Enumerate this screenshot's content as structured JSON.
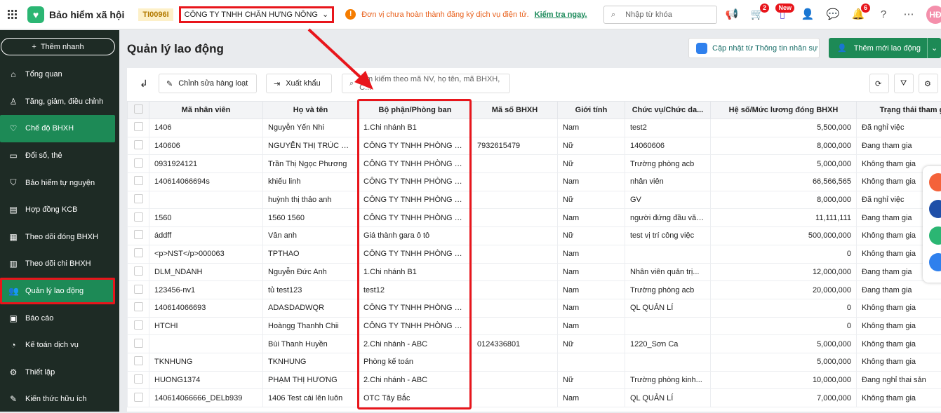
{
  "topbar": {
    "app_title": "Bảo hiểm xã hội",
    "tax_code": "TI0096I",
    "company": "CÔNG TY TNHH CHĂN HƯNG NÔNG",
    "warning": "Đơn vị chưa hoàn thành đăng ký dịch vụ điện tử.",
    "warning_link": "Kiểm tra ngay.",
    "search_placeholder": "Nhập từ khóa",
    "cart_badge": "2",
    "new_badge": "New",
    "bell_badge": "6",
    "avatar": "HĐ"
  },
  "sidebar": {
    "quick_add": "Thêm nhanh",
    "items": [
      {
        "label": "Tổng quan",
        "icon": "⌂"
      },
      {
        "label": "Tăng, giảm, điều chỉnh",
        "icon": "♙"
      },
      {
        "label": "Chế độ BHXH",
        "icon": "♡"
      },
      {
        "label": "Đổi số, thẻ",
        "icon": "▭"
      },
      {
        "label": "Bảo hiểm tự nguyện",
        "icon": "⛉"
      },
      {
        "label": "Hợp đồng KCB",
        "icon": "▤"
      },
      {
        "label": "Theo dõi đóng BHXH",
        "icon": "▦"
      },
      {
        "label": "Theo dõi chi BHXH",
        "icon": "▥"
      },
      {
        "label": "Quản lý lao động",
        "icon": "👥"
      },
      {
        "label": "Báo cáo",
        "icon": "▣"
      },
      {
        "label": "Kế toán dịch vụ",
        "icon": "◔"
      },
      {
        "label": "Thiết lập",
        "icon": "⚙"
      },
      {
        "label": "Kiến thức hữu ích",
        "icon": "✎"
      }
    ]
  },
  "page": {
    "title": "Quản lý lao động",
    "sync_label": "Cập nhật từ Thông tin nhân sự",
    "add_label": "Thêm mới lao động"
  },
  "toolbar": {
    "bulk_edit": "Chỉnh sửa hàng loạt",
    "export": "Xuất khẩu",
    "search_placeholder": "Tìm kiếm theo mã NV, họ tên, mã BHXH, C..."
  },
  "table": {
    "headers": [
      "Mã nhân viên",
      "Họ và tên",
      "Bộ phận/Phòng ban",
      "Mã số BHXH",
      "Giới tính",
      "Chức vụ/Chức da...",
      "Hệ số/Mức lương đóng BHXH",
      "Trạng thái tham gi"
    ],
    "rows": [
      [
        "1406",
        "Nguyễn Yến Nhi",
        "1.Chi nhánh B1",
        "",
        "Nam",
        "test2",
        "5,500,000",
        "Đã nghỉ việc"
      ],
      [
        "140606",
        "NGUYỄN THỊ TRÚC LINH",
        "CÔNG TY TNHH PHÒNG QTD...",
        "7932615479",
        "Nữ",
        "14060606",
        "8,000,000",
        "Đang tham gia"
      ],
      [
        "0931924121",
        "Trần Thị Ngọc Phương",
        "CÔNG TY TNHH PHÒNG QTD...",
        "",
        "Nữ",
        "Trường phòng acb",
        "5,000,000",
        "Không tham gia"
      ],
      [
        "140614066694s",
        "khiếu linh",
        "CÔNG TY TNHH PHÒNG QTD...",
        "",
        "Nam",
        "nhân viên",
        "66,566,565",
        "Không tham gia"
      ],
      [
        "",
        "huỳnh thị thảo anh",
        "CÔNG TY TNHH PHÒNG QTD...",
        "",
        "Nữ",
        "GV",
        "8,000,000",
        "Đã nghỉ việc"
      ],
      [
        "1560",
        "1560 1560",
        "CÔNG TY TNHH PHÒNG QTD...",
        "",
        "Nam",
        "người đứng đầu văn...",
        "11,111,111",
        "Đang tham gia"
      ],
      [
        "áddff",
        "Vân anh",
        "Giá thành gara ô tô",
        "",
        "Nữ",
        "test vị trí công việc",
        "500,000,000",
        "Không tham gia"
      ],
      [
        "<p>NST</p>000063",
        "TPTHAO",
        "CÔNG TY TNHH PHÒNG QTD...",
        "",
        "Nam",
        "",
        "0",
        "Không tham gia"
      ],
      [
        "DLM_NDANH",
        "Nguyễn Đức Anh",
        "1.Chi nhánh B1",
        "",
        "Nam",
        "Nhân viên quản trị...",
        "12,000,000",
        "Đang tham gia"
      ],
      [
        "123456-nv1",
        "tủ test123",
        "test12",
        "",
        "Nam",
        "Trường phòng acb",
        "20,000,000",
        "Đang tham gia"
      ],
      [
        "140614066693",
        "ADASDADWQR",
        "CÔNG TY TNHH PHÒNG QTD...",
        "",
        "Nam",
        "QL QUẢN LÍ",
        "0",
        "Không tham gia"
      ],
      [
        "HTCHI",
        "Hoàngg Thanhh Chii",
        "CÔNG TY TNHH PHÒNG QTD...",
        "",
        "Nam",
        "",
        "0",
        "Không tham gia"
      ],
      [
        "",
        "Bùi Thanh Huyền",
        "2.Chi nhánh - ABC",
        "0124336801",
        "Nữ",
        "1220_Sơn Ca",
        "5,000,000",
        "Không tham gia"
      ],
      [
        "TKNHUNG",
        "TKNHUNG",
        "Phòng kế toán",
        "",
        "",
        "",
        "5,000,000",
        "Không tham gia"
      ],
      [
        "HUONG1374",
        "PHẠM THỊ HƯƠNG",
        "2.Chi nhánh - ABC",
        "",
        "Nữ",
        "Trường phòng kinh...",
        "10,000,000",
        "Đang nghỉ thai sản"
      ],
      [
        "140614066666_DELb939",
        "1406 Test cái lên luôn",
        "OTC Tây Bắc",
        "",
        "Nam",
        "QL QUẢN LÍ",
        "7,000,000",
        "Không tham gia"
      ]
    ]
  }
}
